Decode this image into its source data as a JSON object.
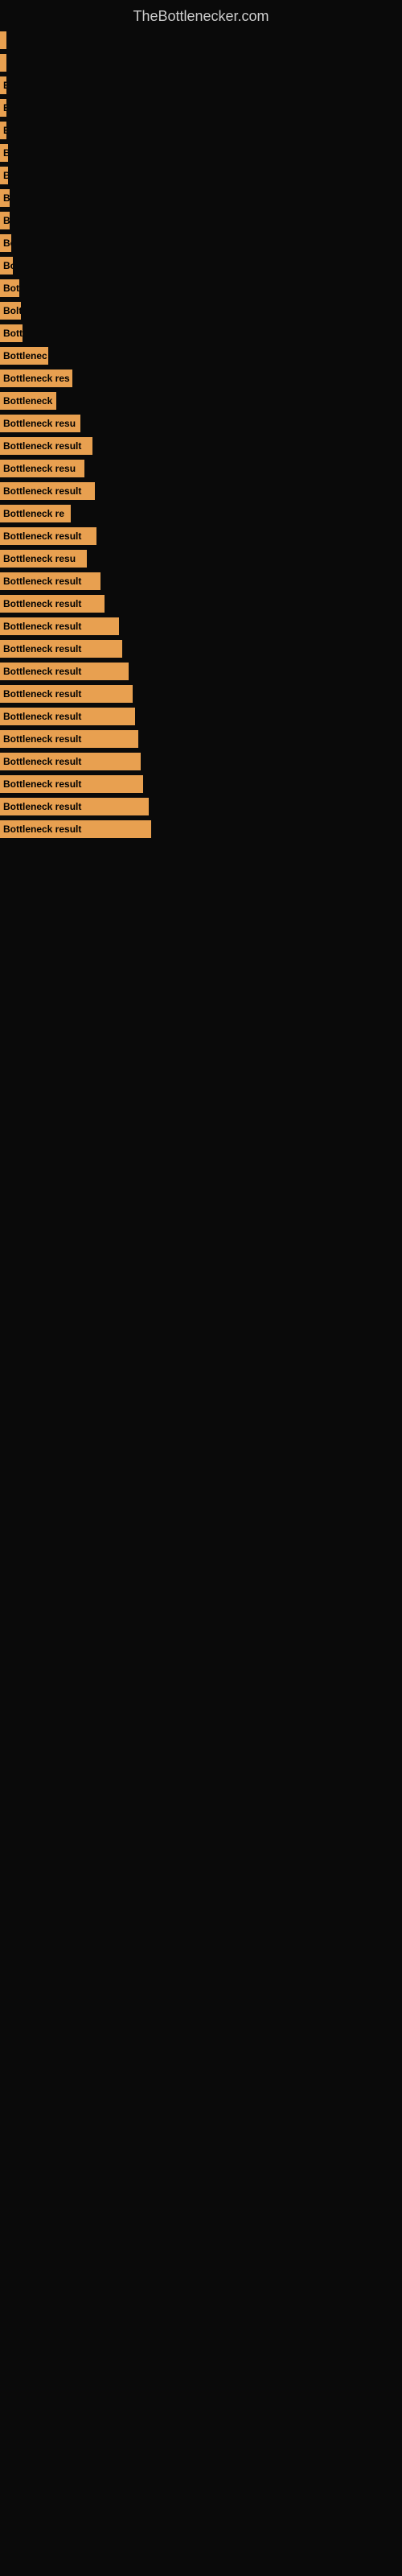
{
  "site": {
    "title": "TheBottlenecker.com"
  },
  "bars": [
    {
      "label": "",
      "width": 4,
      "text": ""
    },
    {
      "label": "",
      "width": 4,
      "text": ""
    },
    {
      "label": "E",
      "width": 6,
      "text": "E"
    },
    {
      "label": "E",
      "width": 8,
      "text": "E"
    },
    {
      "label": "E",
      "width": 8,
      "text": "E"
    },
    {
      "label": "B",
      "width": 10,
      "text": "B"
    },
    {
      "label": "B",
      "width": 10,
      "text": "B"
    },
    {
      "label": "B",
      "width": 12,
      "text": "B"
    },
    {
      "label": "B",
      "width": 12,
      "text": "B"
    },
    {
      "label": "Bo",
      "width": 14,
      "text": "Bo"
    },
    {
      "label": "Bo",
      "width": 16,
      "text": "Bo"
    },
    {
      "label": "Bott",
      "width": 24,
      "text": "Bott"
    },
    {
      "label": "Bolt",
      "width": 26,
      "text": "Bolt"
    },
    {
      "label": "Bott",
      "width": 28,
      "text": "Bott"
    },
    {
      "label": "Bottlenec",
      "width": 60,
      "text": "Bottlenec"
    },
    {
      "label": "Bottleneck res",
      "width": 90,
      "text": "Bottleneck res"
    },
    {
      "label": "Bottleneck",
      "width": 70,
      "text": "Bottleneck"
    },
    {
      "label": "Bottleneck resu",
      "width": 100,
      "text": "Bottleneck resu"
    },
    {
      "label": "Bottleneck result",
      "width": 115,
      "text": "Bottleneck result"
    },
    {
      "label": "Bottleneck resu",
      "width": 105,
      "text": "Bottleneck resu"
    },
    {
      "label": "Bottleneck result",
      "width": 118,
      "text": "Bottleneck result"
    },
    {
      "label": "Bottleneck re",
      "width": 88,
      "text": "Bottleneck re"
    },
    {
      "label": "Bottleneck result",
      "width": 120,
      "text": "Bottleneck result"
    },
    {
      "label": "Bottleneck resu",
      "width": 108,
      "text": "Bottleneck resu"
    },
    {
      "label": "Bottleneck result",
      "width": 125,
      "text": "Bottleneck result"
    },
    {
      "label": "Bottleneck result",
      "width": 130,
      "text": "Bottleneck result"
    },
    {
      "label": "Bottleneck result",
      "width": 148,
      "text": "Bottleneck result"
    },
    {
      "label": "Bottleneck result",
      "width": 152,
      "text": "Bottleneck result"
    },
    {
      "label": "Bottleneck result",
      "width": 160,
      "text": "Bottleneck result"
    },
    {
      "label": "Bottleneck result",
      "width": 165,
      "text": "Bottleneck result"
    },
    {
      "label": "Bottleneck result",
      "width": 168,
      "text": "Bottleneck result"
    },
    {
      "label": "Bottleneck result",
      "width": 172,
      "text": "Bottleneck result"
    },
    {
      "label": "Bottleneck result",
      "width": 175,
      "text": "Bottleneck result"
    },
    {
      "label": "Bottleneck result",
      "width": 178,
      "text": "Bottleneck result"
    },
    {
      "label": "Bottleneck result",
      "width": 185,
      "text": "Bottleneck result"
    },
    {
      "label": "Bottleneck result",
      "width": 188,
      "text": "Bottleneck result"
    }
  ]
}
